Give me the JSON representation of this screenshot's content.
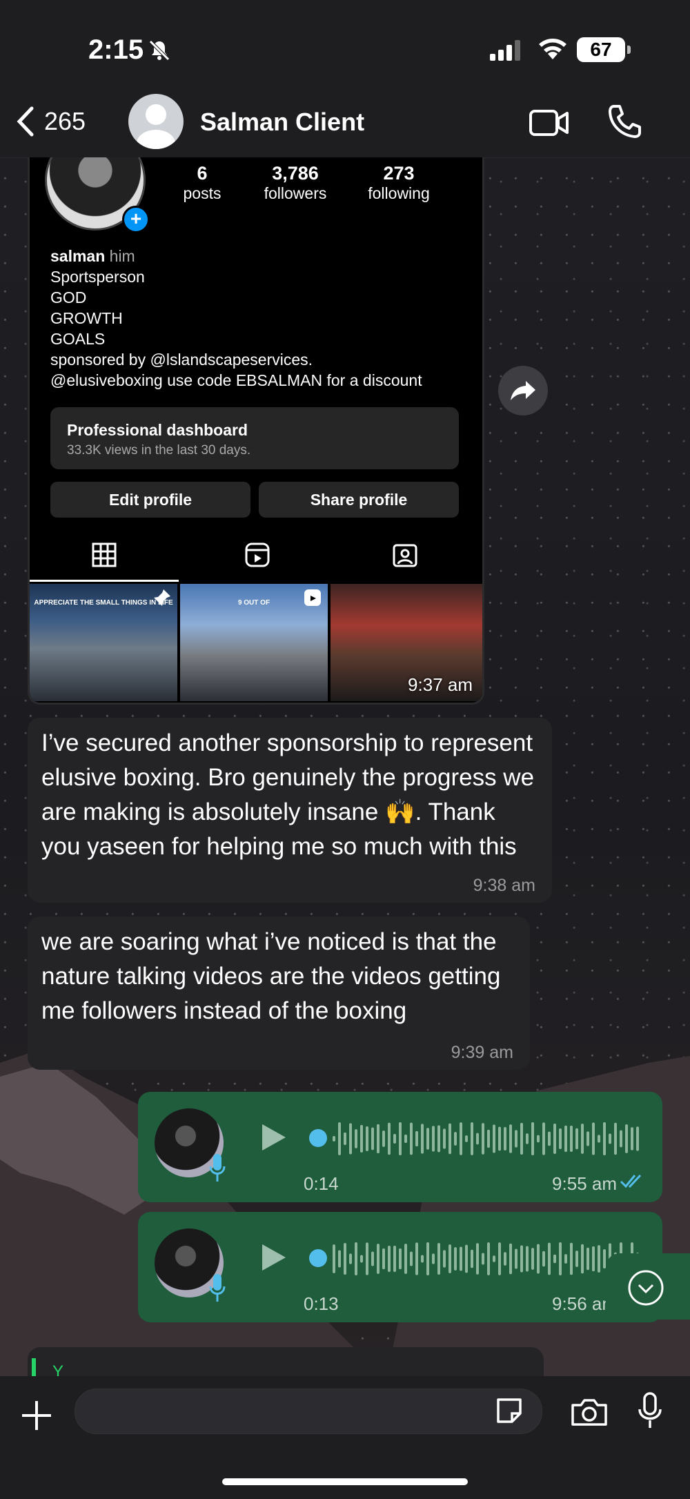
{
  "status_bar": {
    "time": "2:15",
    "battery": "67"
  },
  "header": {
    "back_count": "265",
    "contact_name": "Salman Client"
  },
  "ig_screenshot": {
    "stats": [
      {
        "value": "6",
        "label": "posts"
      },
      {
        "value": "3,786",
        "label": "followers"
      },
      {
        "value": "273",
        "label": "following"
      }
    ],
    "name": "salman",
    "pronoun": "him",
    "bio_lines": [
      "Sportsperson",
      "GOD",
      "GROWTH",
      "GOALS",
      "sponsored by @lslandscapeservices.",
      "@elusiveboxing use code EBSALMAN for a discount"
    ],
    "dashboard_title": "Professional dashboard",
    "dashboard_sub": "33.3K views in the last 30 days.",
    "edit_label": "Edit profile",
    "share_label": "Share profile",
    "thumb1_caption": "APPRECIATE THE SMALL THINGS IN LIFE",
    "thumb2_caption": "9 OUT OF",
    "time": "9:37 am"
  },
  "messages": [
    {
      "text": "I’ve secured another sponsorship to represent elusive boxing. Bro genuinely the progress we are making is absolutely insane 🙌.  Thank you yaseen for helping me so much with this",
      "time": "9:38 am"
    },
    {
      "text": "we are soaring what i’ve noticed is that the nature talking videos are the videos getting me followers instead of the boxing",
      "time": "9:39 am"
    }
  ],
  "voice_notes": [
    {
      "duration": "0:14",
      "time": "9:55 am"
    },
    {
      "duration": "0:13",
      "time": "9:56 am"
    }
  ],
  "preview_text": "Y",
  "colors": {
    "outgoing": "#1f5d3c",
    "incoming": "#242427",
    "accent": "#53bdeb"
  }
}
